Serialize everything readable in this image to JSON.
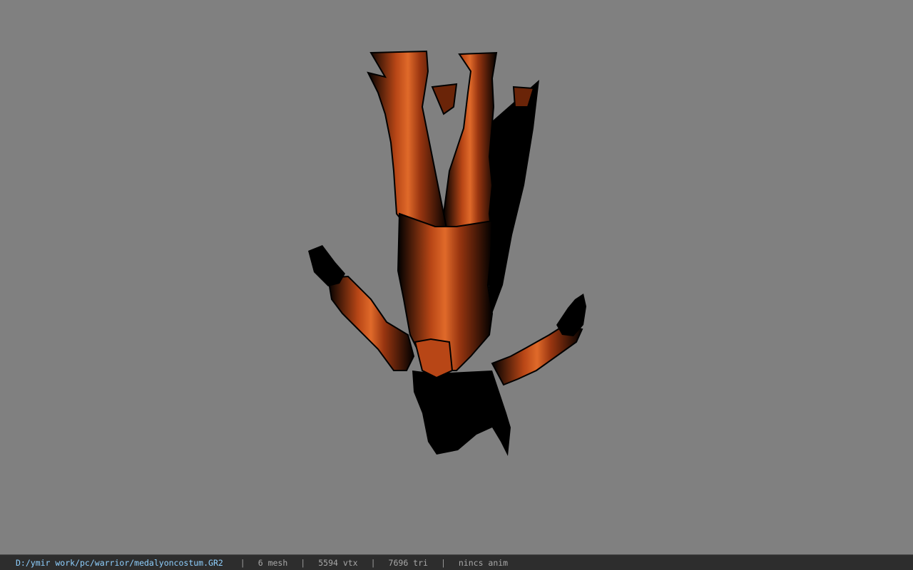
{
  "viewer": {
    "background_color": "#808080",
    "model_primary_color": "#c8501a",
    "model_shadow_color": "#000000"
  },
  "status": {
    "file_path": "D:/ymir work/pc/warrior/medalyoncostum.GR2",
    "separator": "|",
    "mesh_count": "6 mesh",
    "vertex_count": "5594 vtx",
    "triangle_count": "7696 tri",
    "animation": "nincs anim"
  }
}
